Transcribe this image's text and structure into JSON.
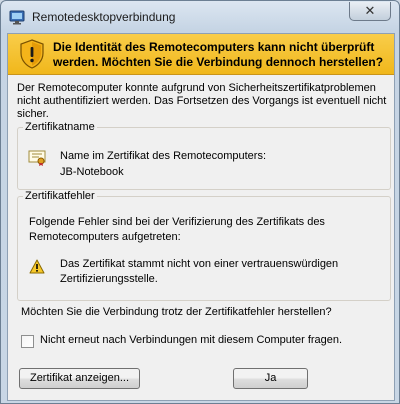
{
  "window": {
    "title": "Remotedesktopverbindung",
    "close_glyph": "✕"
  },
  "warning": {
    "headline": "Die Identität des Remotecomputers kann nicht überprüft werden. Möchten Sie die Verbindung dennoch herstellen?",
    "icon": "warning-shield-icon"
  },
  "description": "Der Remotecomputer konnte aufgrund von Sicherheitszertifikatproblemen nicht authentifiziert werden. Das Fortsetzen des Vorgangs ist eventuell nicht sicher.",
  "certificate_name_group": {
    "legend": "Zertifikatname",
    "label": "Name im Zertifikat des Remotecomputers:",
    "value": "JB-Notebook"
  },
  "certificate_error_group": {
    "legend": "Zertifikatfehler",
    "intro": "Folgende Fehler sind bei der Verifizierung des Zertifikats des Remotecomputers aufgetreten:",
    "error": "Das Zertifikat stammt nicht von einer vertrauenswürdigen Zertifizierungsstelle."
  },
  "question": "Möchten Sie die Verbindung trotz der Zertifikatfehler herstellen?",
  "dont_ask_checkbox": {
    "label": "Nicht erneut nach Verbindungen mit diesem Computer fragen.",
    "checked": false
  },
  "buttons": {
    "view_certificate": "Zertifikat anzeigen...",
    "yes": "Ja"
  },
  "colors": {
    "warning_bar": "#f0b71b",
    "window_frame": "#c5d4e4"
  }
}
